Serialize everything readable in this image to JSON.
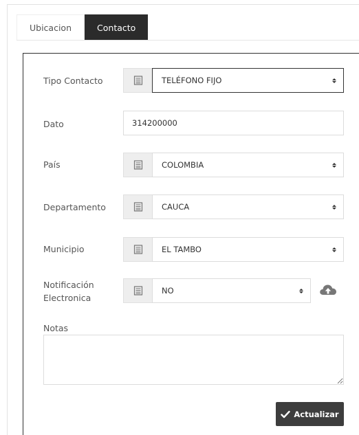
{
  "tabs": [
    {
      "label": "Ubicacion",
      "active": false
    },
    {
      "label": "Contacto",
      "active": true
    }
  ],
  "form": {
    "tipo_contacto": {
      "label": "Tipo Contacto",
      "value": "TELÉFONO FIJO",
      "icon": "list-icon"
    },
    "dato": {
      "label": "Dato",
      "value": "314200000"
    },
    "pais": {
      "label": "País",
      "value": "COLOMBIA",
      "icon": "list-icon"
    },
    "departamento": {
      "label": "Departamento",
      "value": "CAUCA",
      "icon": "list-icon"
    },
    "municipio": {
      "label": "Municipio",
      "value": "EL TAMBO",
      "icon": "list-icon"
    },
    "notificacion": {
      "label_line1": "Notificación",
      "label_line2": "Electronica",
      "value": "NO",
      "icon": "list-icon",
      "upload_icon": "cloud-upload-icon"
    },
    "notas": {
      "label": "Notas",
      "value": ""
    }
  },
  "actions": {
    "update_label": "Actualizar",
    "update_icon": "check-icon"
  },
  "colors": {
    "active_tab_bg": "#2b2b2b",
    "button_bg": "#3d3d3d",
    "addon_bg": "#eeeeee"
  }
}
